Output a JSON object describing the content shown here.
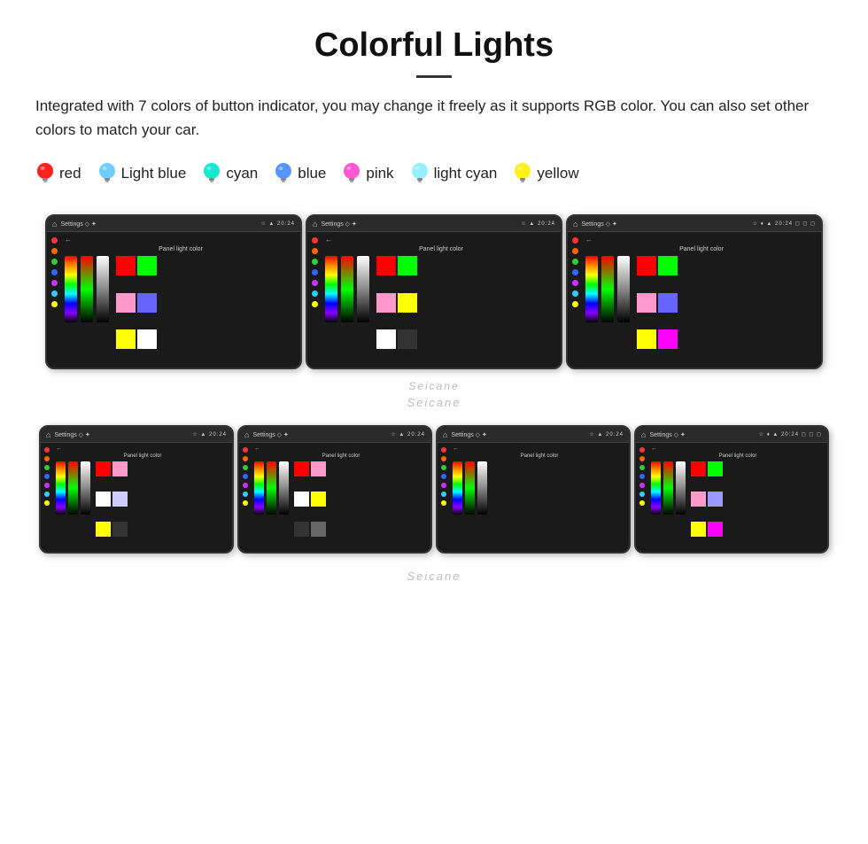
{
  "title": "Colorful Lights",
  "description": "Integrated with 7 colors of button indicator, you may change it freely as it supports RGB color. You can also set other colors to match your car.",
  "colors": [
    {
      "name": "red",
      "color": "#ff2020",
      "bulb_type": "round"
    },
    {
      "name": "Light blue",
      "color": "#60c8ff",
      "bulb_type": "round"
    },
    {
      "name": "cyan",
      "color": "#00e5cc",
      "bulb_type": "round"
    },
    {
      "name": "blue",
      "color": "#4488ff",
      "bulb_type": "round"
    },
    {
      "name": "pink",
      "color": "#ff44cc",
      "bulb_type": "round"
    },
    {
      "name": "light cyan",
      "color": "#88eeff",
      "bulb_type": "round"
    },
    {
      "name": "yellow",
      "color": "#ffee00",
      "bulb_type": "round"
    }
  ],
  "watermark": "Seicane",
  "panel_label": "Panel light color",
  "top_screens": [
    {
      "id": "screen-top-1"
    },
    {
      "id": "screen-top-2"
    },
    {
      "id": "screen-top-3"
    }
  ],
  "bottom_screens": [
    {
      "id": "screen-bot-1"
    },
    {
      "id": "screen-bot-2"
    },
    {
      "id": "screen-bot-3"
    },
    {
      "id": "screen-bot-4"
    }
  ]
}
